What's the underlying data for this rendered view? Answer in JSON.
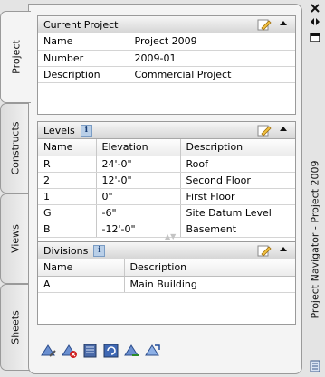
{
  "side_tabs": [
    "Project",
    "Constructs",
    "Views",
    "Sheets"
  ],
  "current_project": {
    "title": "Current Project",
    "rows": [
      {
        "label": "Name",
        "value": "Project 2009"
      },
      {
        "label": "Number",
        "value": "2009-01"
      },
      {
        "label": "Description",
        "value": "Commercial Project"
      }
    ]
  },
  "levels": {
    "title": "Levels",
    "columns": [
      "Name",
      "Elevation",
      "Description"
    ],
    "rows": [
      {
        "name": "R",
        "elevation": "24'-0\"",
        "description": "Roof"
      },
      {
        "name": "2",
        "elevation": "12'-0\"",
        "description": "Second Floor"
      },
      {
        "name": "1",
        "elevation": "0\"",
        "description": "First Floor"
      },
      {
        "name": "G",
        "elevation": "-6\"",
        "description": "Site Datum Level"
      },
      {
        "name": "B",
        "elevation": "-12'-0\"",
        "description": "Basement"
      }
    ]
  },
  "divisions": {
    "title": "Divisions",
    "columns": [
      "Name",
      "Description"
    ],
    "rows": [
      {
        "name": "A",
        "description": "Main Building"
      }
    ]
  },
  "palette_title": "Project Navigator - Project 2009",
  "icons": {
    "close": "close-icon",
    "autohide": "autohide-icon",
    "properties": "properties-icon",
    "info": "i",
    "palette_menu": "palette-menu-icon"
  }
}
